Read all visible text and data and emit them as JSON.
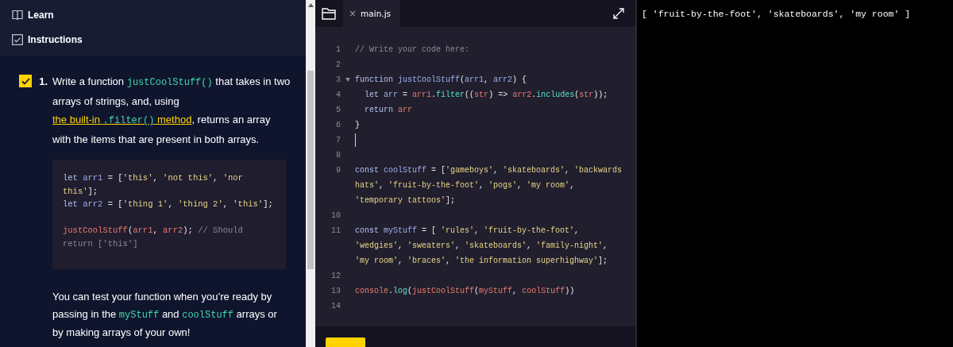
{
  "sidebar": {
    "nav": [
      {
        "label": "Learn"
      },
      {
        "label": "Instructions"
      }
    ],
    "steps": [
      {
        "number": "1.",
        "checked": true,
        "parts": [
          {
            "kind": "text",
            "text": "Write a function "
          },
          {
            "kind": "code",
            "text": "justCoolStuff()"
          },
          {
            "kind": "text",
            "text": " that takes in two arrays of strings, and, using "
          },
          {
            "kind": "link",
            "segments": [
              {
                "text": "the built-in ",
                "kind": "text"
              }
            ]
          },
          {
            "kind": "link",
            "segments": [
              {
                "text": ".filter()",
                "kind": "code"
              },
              {
                "text": " method",
                "kind": "text"
              }
            ]
          },
          {
            "kind": "text",
            "text": ", returns an array with the items that are present in both arrays."
          }
        ]
      }
    ],
    "example": {
      "rows": [
        {
          "tokens": [
            {
              "text": "let ",
              "kind": "keyword"
            },
            {
              "text": "arr1",
              "kind": "name"
            },
            {
              "text": " = [",
              "kind": "punct"
            },
            {
              "text": "'this'",
              "kind": "string"
            },
            {
              "text": ", ",
              "kind": "punct"
            },
            {
              "text": "'not this'",
              "kind": "string"
            },
            {
              "text": ", ",
              "kind": "punct"
            },
            {
              "text": "'nor",
              "kind": "string"
            }
          ]
        },
        {
          "tokens": [
            {
              "text": "this'",
              "kind": "string"
            },
            {
              "text": "];",
              "kind": "punct"
            }
          ]
        },
        {
          "tokens": [
            {
              "text": "let ",
              "kind": "keyword"
            },
            {
              "text": "arr2",
              "kind": "name"
            },
            {
              "text": " = [",
              "kind": "punct"
            },
            {
              "text": "'thing 1'",
              "kind": "string"
            },
            {
              "text": ", ",
              "kind": "punct"
            },
            {
              "text": "'thing 2'",
              "kind": "string"
            },
            {
              "text": ", ",
              "kind": "punct"
            },
            {
              "text": "'this'",
              "kind": "string"
            },
            {
              "text": "];",
              "kind": "punct"
            }
          ]
        },
        {
          "tokens": []
        },
        {
          "tokens": [
            {
              "text": "justCoolStuff",
              "kind": "call"
            },
            {
              "text": "(",
              "kind": "punct"
            },
            {
              "text": "arr1",
              "kind": "call"
            },
            {
              "text": ", ",
              "kind": "punct"
            },
            {
              "text": "arr2",
              "kind": "call"
            },
            {
              "text": "); ",
              "kind": "punct"
            },
            {
              "text": "// Should",
              "kind": "comment"
            }
          ]
        },
        {
          "tokens": [
            {
              "text": "return ['this']",
              "kind": "comment"
            }
          ]
        }
      ]
    },
    "note": [
      {
        "kind": "text",
        "text": "You can test your function when you’re ready by passing in the "
      },
      {
        "kind": "code",
        "text": "myStuff"
      },
      {
        "kind": "text",
        "text": " and "
      },
      {
        "kind": "code",
        "text": "coolStuff"
      },
      {
        "kind": "text",
        "text": " arrays or by making arrays of your own!"
      }
    ]
  },
  "editor": {
    "tabs": [
      {
        "label": "main.js",
        "close": "×",
        "selected": true
      }
    ],
    "lines": [
      {
        "number": "1",
        "rows": [
          {
            "tokens": [
              {
                "text": "// Write your code here:",
                "kind": "comment"
              }
            ]
          }
        ]
      },
      {
        "number": "2",
        "rows": [
          {
            "tokens": []
          }
        ]
      },
      {
        "number": "3",
        "fold": true,
        "rows": [
          {
            "tokens": [
              {
                "text": "function ",
                "kind": "keyword"
              },
              {
                "text": "justCoolStuff",
                "kind": "name"
              },
              {
                "text": "(",
                "kind": "punct"
              },
              {
                "text": "arr1",
                "kind": "name"
              },
              {
                "text": ", ",
                "kind": "punct"
              },
              {
                "text": "arr2",
                "kind": "name"
              },
              {
                "text": ") {",
                "kind": "punct"
              }
            ]
          }
        ]
      },
      {
        "number": "4",
        "rows": [
          {
            "tokens": [
              {
                "text": "  let ",
                "kind": "keyword"
              },
              {
                "text": "arr",
                "kind": "name"
              },
              {
                "text": " = ",
                "kind": "punct"
              },
              {
                "text": "arr1",
                "kind": "call"
              },
              {
                "text": ".",
                "kind": "punct"
              },
              {
                "text": "filter",
                "kind": "method"
              },
              {
                "text": "((",
                "kind": "punct"
              },
              {
                "text": "str",
                "kind": "call"
              },
              {
                "text": ") => ",
                "kind": "punct"
              },
              {
                "text": "arr2",
                "kind": "call"
              },
              {
                "text": ".",
                "kind": "punct"
              },
              {
                "text": "includes",
                "kind": "method"
              },
              {
                "text": "(",
                "kind": "punct"
              },
              {
                "text": "str",
                "kind": "call"
              },
              {
                "text": "));",
                "kind": "punct"
              }
            ]
          }
        ]
      },
      {
        "number": "5",
        "rows": [
          {
            "tokens": [
              {
                "text": "  return ",
                "kind": "keyword"
              },
              {
                "text": "arr",
                "kind": "call"
              }
            ]
          }
        ]
      },
      {
        "number": "6",
        "rows": [
          {
            "tokens": [
              {
                "text": "}",
                "kind": "punct"
              }
            ]
          }
        ]
      },
      {
        "number": "7",
        "cursor": true,
        "rows": [
          {
            "tokens": []
          }
        ]
      },
      {
        "number": "8",
        "rows": [
          {
            "tokens": []
          }
        ]
      },
      {
        "number": "9",
        "rows": [
          {
            "tokens": [
              {
                "text": "const ",
                "kind": "keyword"
              },
              {
                "text": "coolStuff",
                "kind": "name"
              },
              {
                "text": " = [",
                "kind": "punct"
              },
              {
                "text": "'gameboys'",
                "kind": "string"
              },
              {
                "text": ", ",
                "kind": "punct"
              },
              {
                "text": "'skateboards'",
                "kind": "string"
              },
              {
                "text": ", ",
                "kind": "punct"
              },
              {
                "text": "'backwards",
                "kind": "string"
              }
            ]
          },
          {
            "tokens": [
              {
                "text": "hats'",
                "kind": "string"
              },
              {
                "text": ", ",
                "kind": "punct"
              },
              {
                "text": "'fruit-by-the-foot'",
                "kind": "string"
              },
              {
                "text": ", ",
                "kind": "punct"
              },
              {
                "text": "'pogs'",
                "kind": "string"
              },
              {
                "text": ", ",
                "kind": "punct"
              },
              {
                "text": "'my room'",
                "kind": "string"
              },
              {
                "text": ",",
                "kind": "punct"
              }
            ]
          },
          {
            "tokens": [
              {
                "text": "'temporary tattoos'",
                "kind": "string"
              },
              {
                "text": "];",
                "kind": "punct"
              }
            ]
          }
        ]
      },
      {
        "number": "10",
        "rows": [
          {
            "tokens": []
          }
        ]
      },
      {
        "number": "11",
        "rows": [
          {
            "tokens": [
              {
                "text": "const ",
                "kind": "keyword"
              },
              {
                "text": "myStuff",
                "kind": "name"
              },
              {
                "text": " = [ ",
                "kind": "punct"
              },
              {
                "text": "'rules'",
                "kind": "string"
              },
              {
                "text": ", ",
                "kind": "punct"
              },
              {
                "text": "'fruit-by-the-foot'",
                "kind": "string"
              },
              {
                "text": ",",
                "kind": "punct"
              }
            ]
          },
          {
            "tokens": [
              {
                "text": "'wedgies'",
                "kind": "string"
              },
              {
                "text": ", ",
                "kind": "punct"
              },
              {
                "text": "'sweaters'",
                "kind": "string"
              },
              {
                "text": ", ",
                "kind": "punct"
              },
              {
                "text": "'skateboards'",
                "kind": "string"
              },
              {
                "text": ", ",
                "kind": "punct"
              },
              {
                "text": "'family-night'",
                "kind": "string"
              },
              {
                "text": ",",
                "kind": "punct"
              }
            ]
          },
          {
            "tokens": [
              {
                "text": "'my room'",
                "kind": "string"
              },
              {
                "text": ", ",
                "kind": "punct"
              },
              {
                "text": "'braces'",
                "kind": "string"
              },
              {
                "text": ", ",
                "kind": "punct"
              },
              {
                "text": "'the information superhighway'",
                "kind": "string"
              },
              {
                "text": "];",
                "kind": "punct"
              }
            ]
          }
        ]
      },
      {
        "number": "12",
        "rows": [
          {
            "tokens": []
          }
        ]
      },
      {
        "number": "13",
        "rows": [
          {
            "tokens": [
              {
                "text": "console",
                "kind": "call"
              },
              {
                "text": ".",
                "kind": "punct"
              },
              {
                "text": "log",
                "kind": "method"
              },
              {
                "text": "(",
                "kind": "punct"
              },
              {
                "text": "justCoolStuff",
                "kind": "call"
              },
              {
                "text": "(",
                "kind": "punct"
              },
              {
                "text": "myStuff",
                "kind": "call"
              },
              {
                "text": ", ",
                "kind": "punct"
              },
              {
                "text": "coolStuff",
                "kind": "call"
              },
              {
                "text": "))",
                "kind": "punct"
              }
            ]
          }
        ]
      },
      {
        "number": "14",
        "rows": [
          {
            "tokens": []
          }
        ]
      }
    ]
  },
  "console": {
    "output": [
      "[ 'fruit-by-the-foot', 'skateboards', 'my room' ]"
    ]
  }
}
